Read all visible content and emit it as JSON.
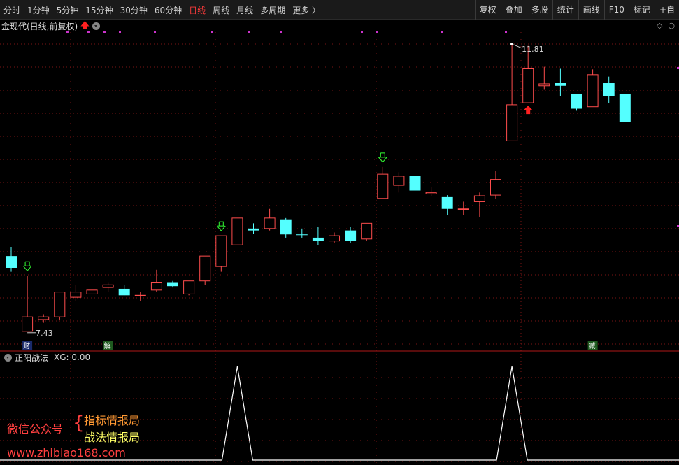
{
  "toolbar": {
    "periods": [
      {
        "label": "分时",
        "active": false
      },
      {
        "label": "1分钟",
        "active": false
      },
      {
        "label": "5分钟",
        "active": false
      },
      {
        "label": "15分钟",
        "active": false
      },
      {
        "label": "30分钟",
        "active": false
      },
      {
        "label": "60分钟",
        "active": false
      },
      {
        "label": "日线",
        "active": true
      },
      {
        "label": "周线",
        "active": false
      },
      {
        "label": "月线",
        "active": false
      },
      {
        "label": "多周期",
        "active": false
      },
      {
        "label": "更多 〉",
        "active": false
      }
    ],
    "right_buttons": [
      "复权",
      "叠加",
      "多股",
      "统计",
      "画线",
      "F10",
      "标记",
      "+自"
    ]
  },
  "main_chart": {
    "title": "金现代(日线,前复权)"
  },
  "indicator": {
    "title": "正阳战法",
    "value_label": "XG: 0.00"
  },
  "watermark": {
    "wechat": "微信公众号",
    "line1": "指标情报局",
    "line2": "战法情报局",
    "site": "www.zhibiao168.com"
  },
  "colors": {
    "up": "#ff4d4d",
    "down": "#54ffff",
    "grid": "#7a1414",
    "signal_arrow": "#33ff33",
    "red_arrow": "#ff2020"
  },
  "chart_data": {
    "type": "candlestick",
    "title": "金现代(日线,前复权)",
    "y_annotations": {
      "high": "11.81",
      "low": "7.43"
    },
    "candles": [
      {
        "o": 8.58,
        "h": 8.72,
        "l": 8.34,
        "c": 8.4
      },
      {
        "o": 7.43,
        "h": 8.28,
        "l": 7.43,
        "c": 7.65
      },
      {
        "o": 7.61,
        "h": 7.69,
        "l": 7.56,
        "c": 7.65
      },
      {
        "o": 7.65,
        "h": 8.03,
        "l": 7.61,
        "c": 8.03
      },
      {
        "o": 7.95,
        "h": 8.14,
        "l": 7.89,
        "c": 8.03
      },
      {
        "o": 8.0,
        "h": 8.12,
        "l": 7.92,
        "c": 8.06
      },
      {
        "o": 8.1,
        "h": 8.17,
        "l": 8.03,
        "c": 8.14
      },
      {
        "o": 8.08,
        "h": 8.14,
        "l": 7.98,
        "c": 7.98
      },
      {
        "o": 7.98,
        "h": 8.03,
        "l": 7.89,
        "c": 7.98
      },
      {
        "o": 8.06,
        "h": 8.37,
        "l": 8.03,
        "c": 8.17
      },
      {
        "o": 8.17,
        "h": 8.2,
        "l": 8.1,
        "c": 8.12
      },
      {
        "o": 8.0,
        "h": 8.2,
        "l": 7.98,
        "c": 8.2
      },
      {
        "o": 8.2,
        "h": 8.58,
        "l": 8.14,
        "c": 8.58
      },
      {
        "o": 8.42,
        "h": 8.89,
        "l": 8.34,
        "c": 8.89
      },
      {
        "o": 8.75,
        "h": 9.16,
        "l": 8.75,
        "c": 9.16
      },
      {
        "o": 9.0,
        "h": 9.08,
        "l": 8.92,
        "c": 8.97
      },
      {
        "o": 9.0,
        "h": 9.3,
        "l": 8.97,
        "c": 9.16
      },
      {
        "o": 9.14,
        "h": 9.16,
        "l": 8.86,
        "c": 8.91
      },
      {
        "o": 8.91,
        "h": 9.0,
        "l": 8.86,
        "c": 8.9
      },
      {
        "o": 8.86,
        "h": 9.03,
        "l": 8.75,
        "c": 8.81
      },
      {
        "o": 8.81,
        "h": 8.94,
        "l": 8.78,
        "c": 8.89
      },
      {
        "o": 8.97,
        "h": 9.03,
        "l": 8.78,
        "c": 8.81
      },
      {
        "o": 8.84,
        "h": 9.08,
        "l": 8.81,
        "c": 9.08
      },
      {
        "o": 9.46,
        "h": 9.94,
        "l": 9.46,
        "c": 9.83
      },
      {
        "o": 9.66,
        "h": 9.86,
        "l": 9.55,
        "c": 9.8
      },
      {
        "o": 9.8,
        "h": 9.8,
        "l": 9.5,
        "c": 9.58
      },
      {
        "o": 9.53,
        "h": 9.64,
        "l": 9.5,
        "c": 9.55
      },
      {
        "o": 9.48,
        "h": 9.51,
        "l": 9.21,
        "c": 9.3
      },
      {
        "o": 9.3,
        "h": 9.41,
        "l": 9.21,
        "c": 9.3
      },
      {
        "o": 9.41,
        "h": 9.55,
        "l": 9.18,
        "c": 9.5
      },
      {
        "o": 9.51,
        "h": 9.88,
        "l": 9.45,
        "c": 9.75
      },
      {
        "o": 10.34,
        "h": 11.81,
        "l": 10.34,
        "c": 10.89
      },
      {
        "o": 10.92,
        "h": 11.79,
        "l": 10.92,
        "c": 11.45
      },
      {
        "o": 11.18,
        "h": 11.47,
        "l": 11.13,
        "c": 11.21
      },
      {
        "o": 11.23,
        "h": 11.45,
        "l": 11.02,
        "c": 11.18
      },
      {
        "o": 11.06,
        "h": 11.06,
        "l": 10.8,
        "c": 10.83
      },
      {
        "o": 10.86,
        "h": 11.43,
        "l": 10.86,
        "c": 11.35
      },
      {
        "o": 11.22,
        "h": 11.32,
        "l": 10.92,
        "c": 11.02
      },
      {
        "o": 11.06,
        "h": 11.06,
        "l": 10.63,
        "c": 10.63
      }
    ],
    "buy_signal_indices": [
      1,
      13,
      23
    ],
    "sell_signal_indices": [
      32
    ],
    "event_labels": [
      {
        "index": 1,
        "text": "财"
      },
      {
        "index": 6,
        "text": "解"
      },
      {
        "index": 36,
        "text": "减"
      }
    ],
    "indicator_peaks": [
      14,
      31
    ]
  }
}
